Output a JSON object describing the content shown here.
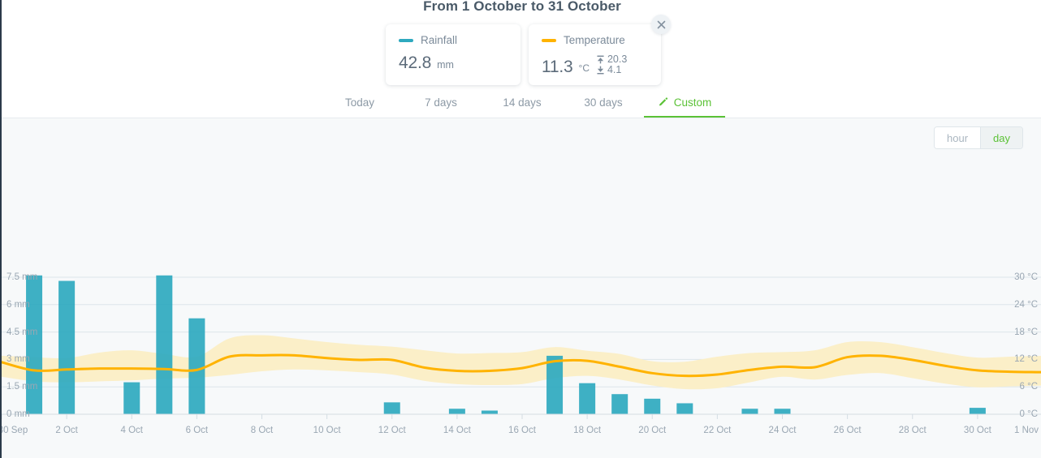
{
  "header": {
    "title": "From 1 October to 31 October"
  },
  "cards": {
    "rainfall": {
      "legend_label": "Rainfall",
      "legend_color": "#2ea9bf",
      "value": "42.8",
      "unit": "mm"
    },
    "temperature": {
      "legend_label": "Temperature",
      "legend_color": "#ffb300",
      "value": "11.3",
      "unit": "°C",
      "max": "20.3",
      "min": "4.1",
      "max_icon": "max-temp-icon",
      "min_icon": "min-temp-icon"
    },
    "close_icon": "close-icon"
  },
  "tabs": [
    {
      "label": "Today",
      "active": false
    },
    {
      "label": "7 days",
      "active": false
    },
    {
      "label": "14 days",
      "active": false
    },
    {
      "label": "30 days",
      "active": false
    },
    {
      "label": "Custom",
      "active": true,
      "icon": "pencil-icon"
    }
  ],
  "granularity": {
    "options": [
      {
        "label": "hour",
        "selected": false
      },
      {
        "label": "day",
        "selected": true
      }
    ]
  },
  "chart_data": {
    "type": "bar",
    "title": "From 1 October to 31 October",
    "xlabel": "",
    "ylabel": "Rainfall",
    "y2label": "Temperature",
    "grid": true,
    "legend_position": "top",
    "left_axis": {
      "ticks": [
        "0 mm",
        "1.5 mm",
        "3 mm",
        "4.5 mm",
        "6 mm",
        "7.5 mm"
      ],
      "values": [
        0,
        1.5,
        3,
        4.5,
        6,
        7.5
      ],
      "unit": "mm",
      "ylim": [
        0,
        8.2
      ]
    },
    "right_axis": {
      "ticks": [
        "0 °C",
        "6 °C",
        "12 °C",
        "18 °C",
        "24 °C",
        "30 °C"
      ],
      "values": [
        0,
        6,
        12,
        18,
        24,
        30
      ],
      "unit": "°C",
      "ylim": [
        0,
        32.8
      ]
    },
    "x_ticks": [
      "30 Sep",
      "2 Oct",
      "4 Oct",
      "6 Oct",
      "8 Oct",
      "10 Oct",
      "12 Oct",
      "14 Oct",
      "16 Oct",
      "18 Oct",
      "20 Oct",
      "22 Oct",
      "24 Oct",
      "26 Oct",
      "28 Oct",
      "30 Oct",
      "1 Nov"
    ],
    "x_tick_days": [
      0,
      2,
      4,
      6,
      8,
      10,
      12,
      14,
      16,
      18,
      20,
      22,
      24,
      26,
      28,
      30,
      32
    ],
    "categories": [
      "30 Sep",
      "1 Oct",
      "2 Oct",
      "3 Oct",
      "4 Oct",
      "5 Oct",
      "6 Oct",
      "7 Oct",
      "8 Oct",
      "9 Oct",
      "10 Oct",
      "11 Oct",
      "12 Oct",
      "13 Oct",
      "14 Oct",
      "15 Oct",
      "16 Oct",
      "17 Oct",
      "18 Oct",
      "19 Oct",
      "20 Oct",
      "21 Oct",
      "22 Oct",
      "23 Oct",
      "24 Oct",
      "25 Oct",
      "26 Oct",
      "27 Oct",
      "28 Oct",
      "29 Oct",
      "30 Oct",
      "31 Oct",
      "1 Nov"
    ],
    "series": [
      {
        "name": "Rainfall",
        "type": "bar",
        "color": "#2ea9bf",
        "unit": "mm",
        "axis": "left",
        "values": [
          0,
          7.6,
          7.3,
          0,
          1.75,
          7.6,
          5.25,
          0,
          0,
          0,
          0,
          0,
          0.65,
          0,
          0.3,
          0.2,
          0,
          3.2,
          1.7,
          1.1,
          0.85,
          0.6,
          0,
          0.3,
          0.3,
          0,
          0,
          0,
          0,
          0,
          0.35,
          0,
          0
        ]
      },
      {
        "name": "Temperature",
        "type": "line",
        "color": "#ffb300",
        "unit": "°C",
        "axis": "right",
        "values": [
          11.4,
          9.6,
          9.8,
          10.0,
          10.0,
          9.9,
          9.7,
          12.6,
          12.9,
          12.9,
          12.3,
          11.9,
          11.9,
          10.2,
          9.5,
          9.5,
          10.1,
          11.6,
          11.7,
          10.4,
          9.0,
          8.4,
          8.7,
          9.7,
          10.4,
          10.3,
          12.5,
          12.8,
          11.9,
          10.6,
          9.6,
          9.3,
          9.2
        ]
      },
      {
        "name": "Temperature range",
        "type": "area",
        "color": "#fbefc8",
        "unit": "°C",
        "axis": "right",
        "upper": [
          12.8,
          12.5,
          12.3,
          13.5,
          14.0,
          13.2,
          12.6,
          16.6,
          17.3,
          16.6,
          15.8,
          15.2,
          14.8,
          14.0,
          13.3,
          13.4,
          13.6,
          14.7,
          13.9,
          13.2,
          11.6,
          11.5,
          12.6,
          13.4,
          13.6,
          14.0,
          15.8,
          15.8,
          14.7,
          13.4,
          12.4,
          12.6,
          12.8
        ],
        "lower": [
          8.2,
          7.2,
          7.0,
          7.2,
          7.4,
          7.8,
          8.0,
          8.6,
          9.4,
          9.8,
          9.6,
          9.2,
          8.7,
          7.3,
          6.6,
          6.4,
          6.6,
          7.9,
          8.4,
          7.6,
          6.3,
          5.5,
          5.7,
          7.0,
          8.2,
          7.6,
          8.6,
          9.0,
          7.9,
          6.7,
          5.9,
          6.1,
          6.3
        ]
      }
    ]
  }
}
